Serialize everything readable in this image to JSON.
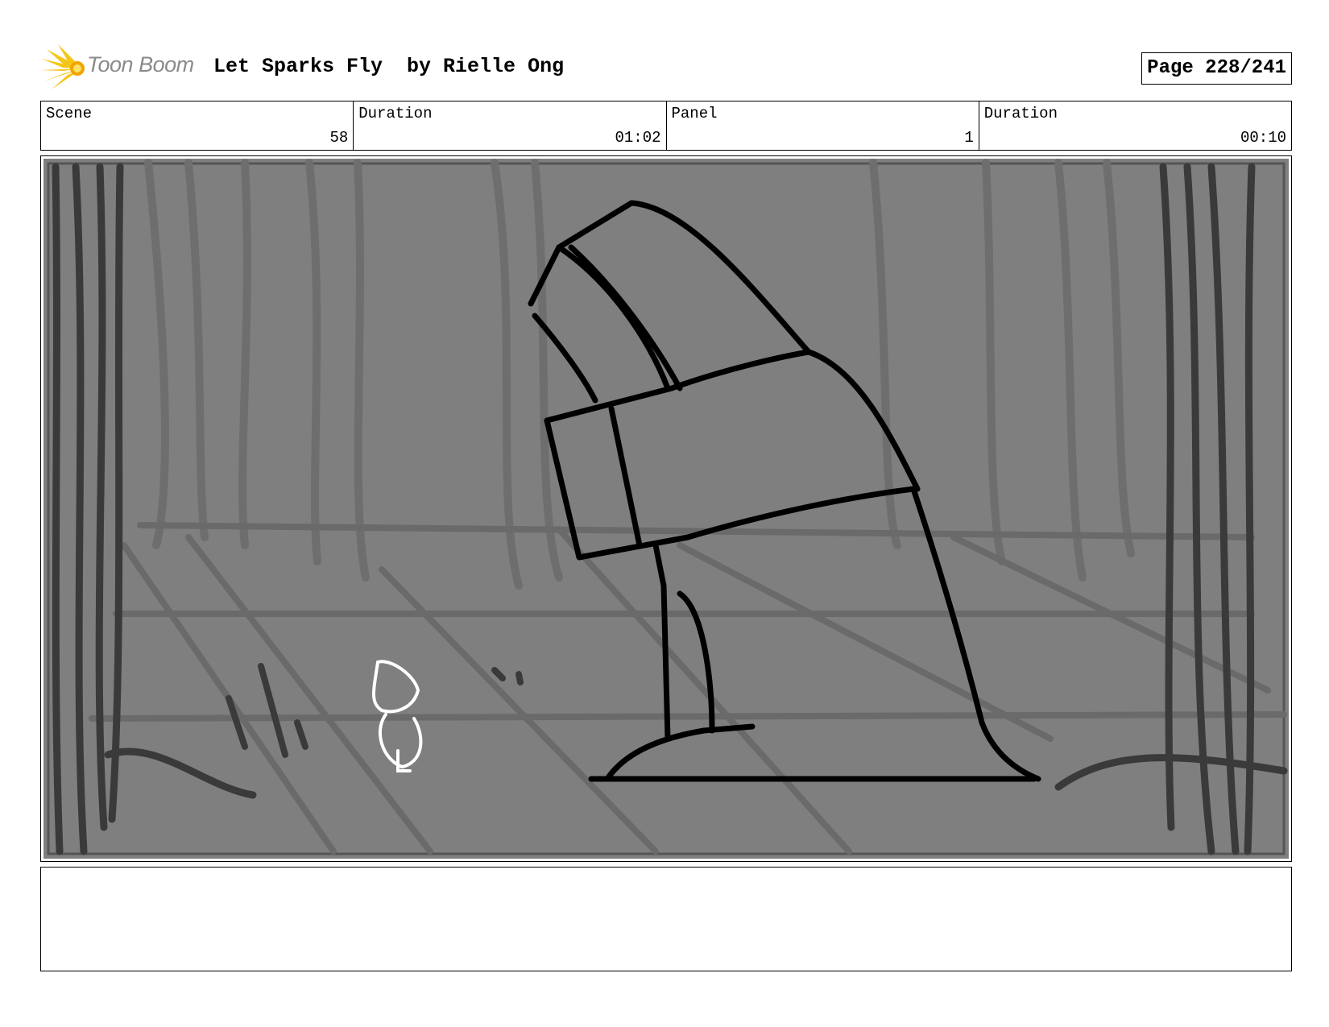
{
  "header": {
    "logo_text": "Toon Boom",
    "title": "Let Sparks Fly  by Rielle Ong",
    "page": "Page 228/241"
  },
  "info": {
    "scene_label": "Scene",
    "scene_value": "58",
    "duration_label": "Duration",
    "duration_value": "01:02",
    "panel_label": "Panel",
    "panel_value": "1",
    "panel_duration_label": "Duration",
    "panel_duration_value": "00:10"
  },
  "notes": {
    "text": ""
  }
}
